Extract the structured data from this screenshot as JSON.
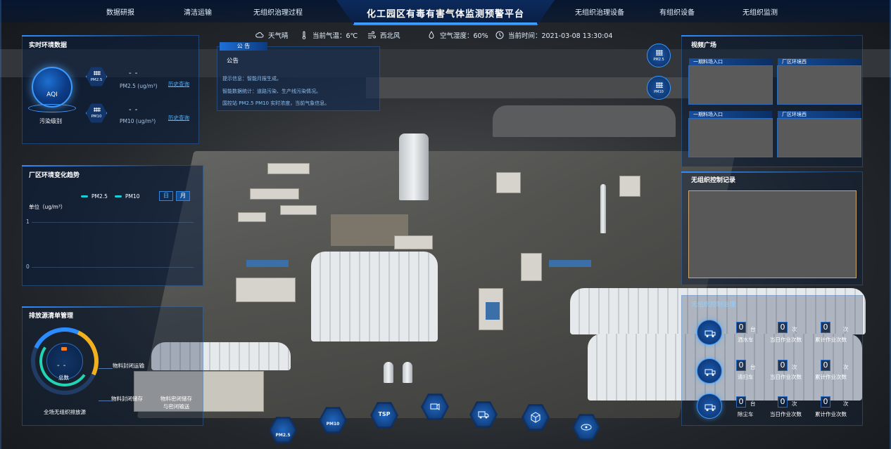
{
  "header": {
    "title": "化工园区有毒有害气体监测预警平台",
    "nav_left": [
      "数据研报",
      "清洁运输",
      "无组织治理过程"
    ],
    "nav_right": [
      "无组织治理设备",
      "有组织设备",
      "无组织监测"
    ]
  },
  "weather": {
    "condition": "天气晴",
    "temperature": "当前气温：6℃",
    "wind": "西北风",
    "humidity": "空气湿度：60%",
    "time": "当前时间：2021-03-08 13:30:04"
  },
  "env_data": {
    "title": "实时环境数据",
    "aqi_label": "AQI",
    "pollution_level_label": "污染级别",
    "pm25_badge": "PM2.5",
    "pm10_badge": "PM10",
    "pm25_value": "- -",
    "pm10_value": "- -",
    "pm25_label": "PM2.5 (ug/m³)",
    "pm10_label": "PM10 (ug/m³)",
    "history_link_1": "历史查询",
    "history_link_2": "历史查询"
  },
  "notice": {
    "tab": "公 告",
    "label": "公告",
    "lines": [
      "提示信息：智能月报生成。",
      "智能数据统计：道路污染、生产线污染情况。",
      "国控站 PM2.5 PM10 实时浓度，当前气象信息。"
    ]
  },
  "trend": {
    "title": "厂区环境变化趋势",
    "legend": [
      "PM2.5",
      "PM10"
    ],
    "toggles": [
      "日",
      "月"
    ],
    "unit": "单位（ug/m³）",
    "y_ticks": [
      "1",
      "0"
    ]
  },
  "emission": {
    "title": "排放源清单管理",
    "gauge_value": "- -",
    "gauge_label": "总数",
    "gauge_caption": "全场无组织排放源",
    "sources": [
      "物料封闭运输",
      "物料封闭储存",
      "物料密闭储存\n与密闭输送"
    ]
  },
  "video": {
    "title": "视频广场",
    "cams": [
      "一期料场入口",
      "厂区环境西",
      "一期料场入口",
      "厂区环境西"
    ]
  },
  "control_record": {
    "title": "无组织控制记录"
  },
  "governance": {
    "title": "无组织控制治理",
    "rows": [
      {
        "device_label": "洒水车",
        "device_value": "0",
        "device_unit": "台",
        "today_label": "当日作业次数",
        "today_value": "0",
        "today_unit": "次",
        "total_label": "累计作业次数",
        "total_value": "0",
        "total_unit": "次"
      },
      {
        "device_label": "清扫车",
        "device_value": "0",
        "device_unit": "台",
        "today_label": "当日作业次数",
        "today_value": "0",
        "today_unit": "次",
        "total_label": "累计作业次数",
        "total_value": "0",
        "total_unit": "次"
      },
      {
        "device_label": "除尘车",
        "device_value": "0",
        "device_unit": "台",
        "today_label": "当日作业次数",
        "today_value": "0",
        "today_unit": "次",
        "total_label": "累计作业次数",
        "total_value": "0",
        "total_unit": "次"
      }
    ]
  },
  "side_icons": [
    "PM2.5",
    "PM10"
  ],
  "toolbar": {
    "pm25": "PM2.5",
    "pm10": "PM10",
    "tsp": "TSP"
  }
}
